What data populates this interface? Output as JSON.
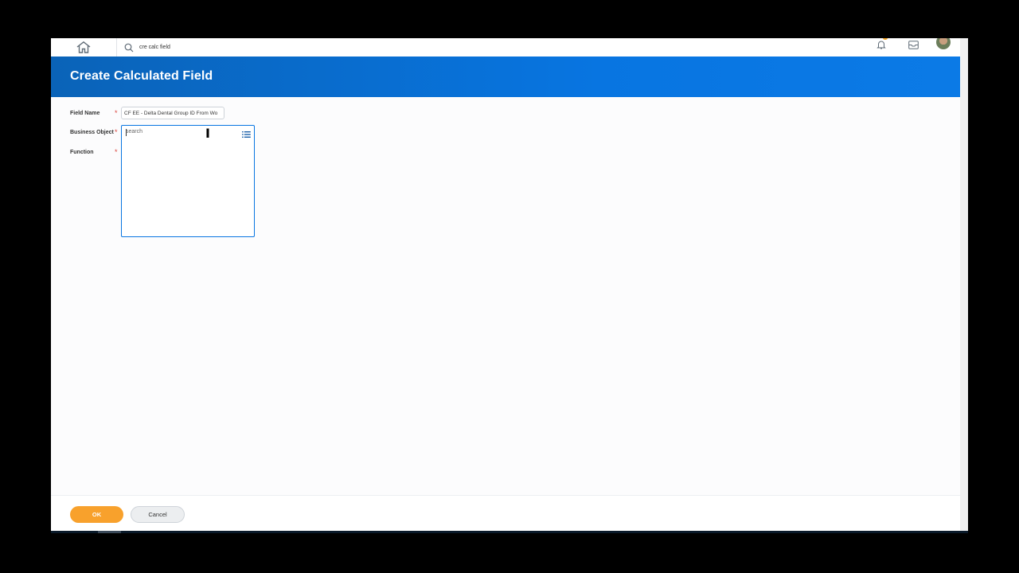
{
  "top_nav": {
    "search_text": "cre calc field",
    "home_icon": "home-icon",
    "notifications_icon": "bell-icon",
    "inbox_icon": "inbox-icon"
  },
  "header": {
    "title": "Create Calculated Field"
  },
  "form": {
    "field_name": {
      "label": "Field Name",
      "required_mark": "*",
      "value": "CF EE - Delta Dental Group ID From Wo"
    },
    "business_object": {
      "label": "Business Object",
      "required_mark": "*",
      "placeholder": "search"
    },
    "function": {
      "label": "Function",
      "required_mark": "*"
    }
  },
  "footer": {
    "ok_label": "OK",
    "cancel_label": "Cancel"
  },
  "colors": {
    "banner": "#0875e1",
    "primary_button": "#f8a12c",
    "required": "#d9413b",
    "notification_badge": "#f5a623"
  }
}
